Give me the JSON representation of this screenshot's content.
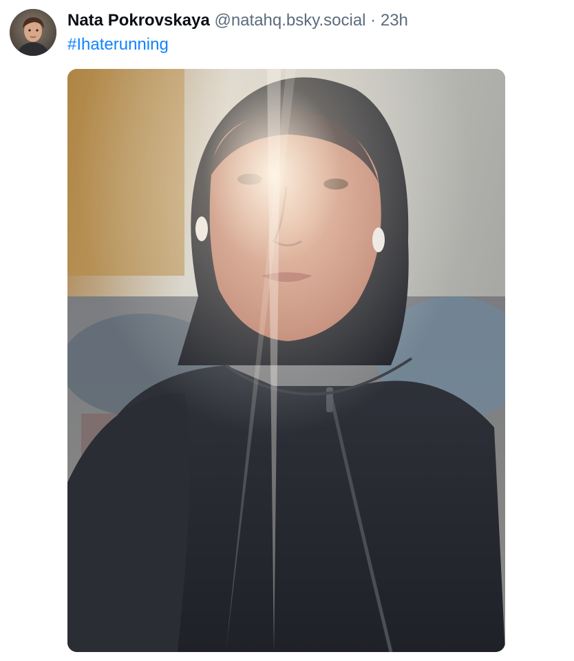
{
  "post": {
    "author": {
      "display_name": "Nata Pokrovskaya",
      "handle": "@natahq.bsky.social",
      "avatar_icon": "user-avatar-photo"
    },
    "separator": "·",
    "timestamp": "23h",
    "text": {
      "hashtag": "#Ihaterunning"
    },
    "media": {
      "alt": "Selfie of a woman in a black hooded running jacket with earbuds, sun flare, blurred parking lot behind"
    }
  },
  "colors": {
    "name": "#0b0f14",
    "secondary_text": "#5b6b7c",
    "link": "#1083fe",
    "background": "#ffffff"
  }
}
